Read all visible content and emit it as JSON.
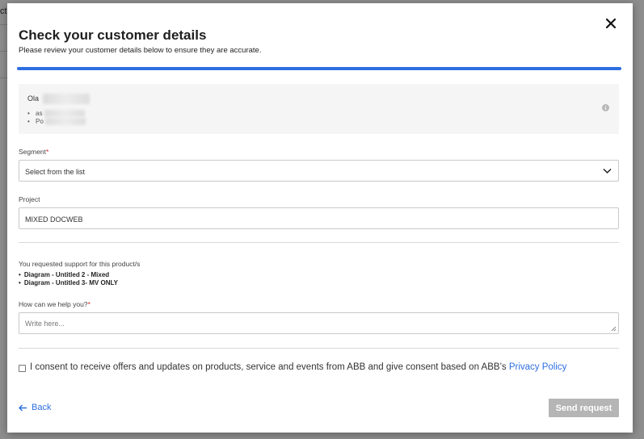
{
  "background": {
    "cut_text": "ct"
  },
  "modal": {
    "title": "Check your customer details",
    "subtitle": "Please review your customer details below to ensure they are accurate.",
    "progress_color": "#2e6fe0",
    "customer": {
      "name_prefix": "Ola",
      "items": [
        "as",
        "Po"
      ]
    },
    "segment": {
      "label": "Segment",
      "required_mark": "*",
      "placeholder": "Select from the list"
    },
    "project": {
      "label": "Project",
      "value": "MIXED DOCWEB"
    },
    "support": {
      "intro": "You requested support for this product/s",
      "products": [
        "Diagram - Untitled 2 - Mixed",
        "Diagram - Untitled 3- MV ONLY"
      ]
    },
    "help": {
      "label": "How can we help you?",
      "required_mark": "*",
      "placeholder": "Write here..."
    },
    "consent": {
      "text": "I consent to receive offers and updates on products, service and events from ABB and give consent based on ABB’s ",
      "link_text": "Privacy Policy",
      "checked": false
    },
    "footer": {
      "back_label": "Back",
      "send_label": "Send request"
    }
  },
  "icons": {
    "close": "close-icon",
    "info": "info-icon",
    "chevron": "chevron-down-icon",
    "back": "arrow-left-icon",
    "resize": "resize-grip-icon"
  },
  "colors": {
    "accent": "#2e6fe0",
    "required": "#dd2222",
    "disabled_button": "#b5b5b5"
  }
}
